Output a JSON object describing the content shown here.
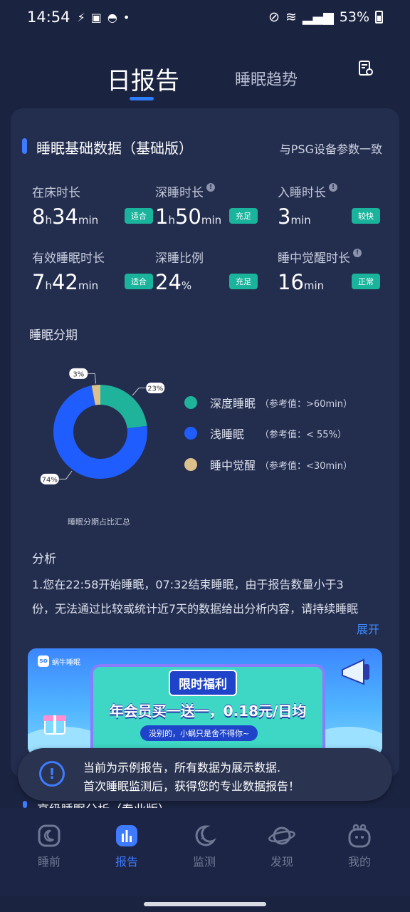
{
  "status": {
    "time": "14:54",
    "battery": "53%"
  },
  "tabs": {
    "active": "日报告",
    "other": "睡眠趋势"
  },
  "card": {
    "title": "睡眠基础数据（基础版）",
    "note": "与PSG设备参数一致",
    "metrics": [
      {
        "label": "在床时长",
        "v1": "8",
        "u1": "h",
        "v2": "34",
        "u2": "min",
        "badge": "适合"
      },
      {
        "label": "深睡时长",
        "v1": "1",
        "u1": "h",
        "v2": "50",
        "u2": "min",
        "badge": "充足"
      },
      {
        "label": "入睡时长",
        "v1": "3",
        "u1": "min",
        "v2": "",
        "u2": "",
        "badge": "较快"
      },
      {
        "label": "有效睡眠时长",
        "v1": "7",
        "u1": "h",
        "v2": "42",
        "u2": "min",
        "badge": "适合"
      },
      {
        "label": "深睡比例",
        "v1": "24",
        "u1": "%",
        "v2": "",
        "u2": "",
        "badge": "充足"
      },
      {
        "label": "睡中觉醒时长",
        "v1": "16",
        "u1": "min",
        "v2": "",
        "u2": "",
        "badge": "正常"
      }
    ],
    "stages_label": "睡眠分期",
    "chart_caption": "睡眠分期占比汇总",
    "analysis_label": "分析",
    "analysis_line1": "1.您在22:58开始睡眠，07:32结束睡眠，由于报告数量小于3",
    "analysis_line2": "份，无法通过比较或统计近7天的数据给出分析内容，请持续睡眠",
    "expand": "展开"
  },
  "chart_data": {
    "type": "pie",
    "categories": [
      "深度睡眠",
      "浅睡眠",
      "睡中觉醒"
    ],
    "values": [
      23,
      74,
      3
    ],
    "labels": [
      "23%",
      "74%",
      "3%"
    ],
    "references": [
      "（参考值：>60min）",
      "（参考值：< 55%）",
      "（参考值：<30min）"
    ],
    "colors": [
      "#1fb39b",
      "#1f5dff",
      "#dcc08c"
    ]
  },
  "banner": {
    "brand": "蜗牛睡眠",
    "title": "限时福利",
    "headline": "年会员买一送一，0.18元/日均",
    "sub": "没别的，小蜗只是舍不得你~"
  },
  "toast": {
    "line1": "当前为示例报告，所有数据为展示数据.",
    "line2": "首次睡眠监测后，获得您的专业数据报告！"
  },
  "peek": "高级睡眠分析（专业版）",
  "nav": [
    {
      "label": "睡前",
      "icon": "moon-box-icon"
    },
    {
      "label": "报告",
      "icon": "bar-chart-icon"
    },
    {
      "label": "监测",
      "icon": "sleep-moon-icon"
    },
    {
      "label": "发现",
      "icon": "planet-icon"
    },
    {
      "label": "我的",
      "icon": "profile-icon"
    }
  ]
}
